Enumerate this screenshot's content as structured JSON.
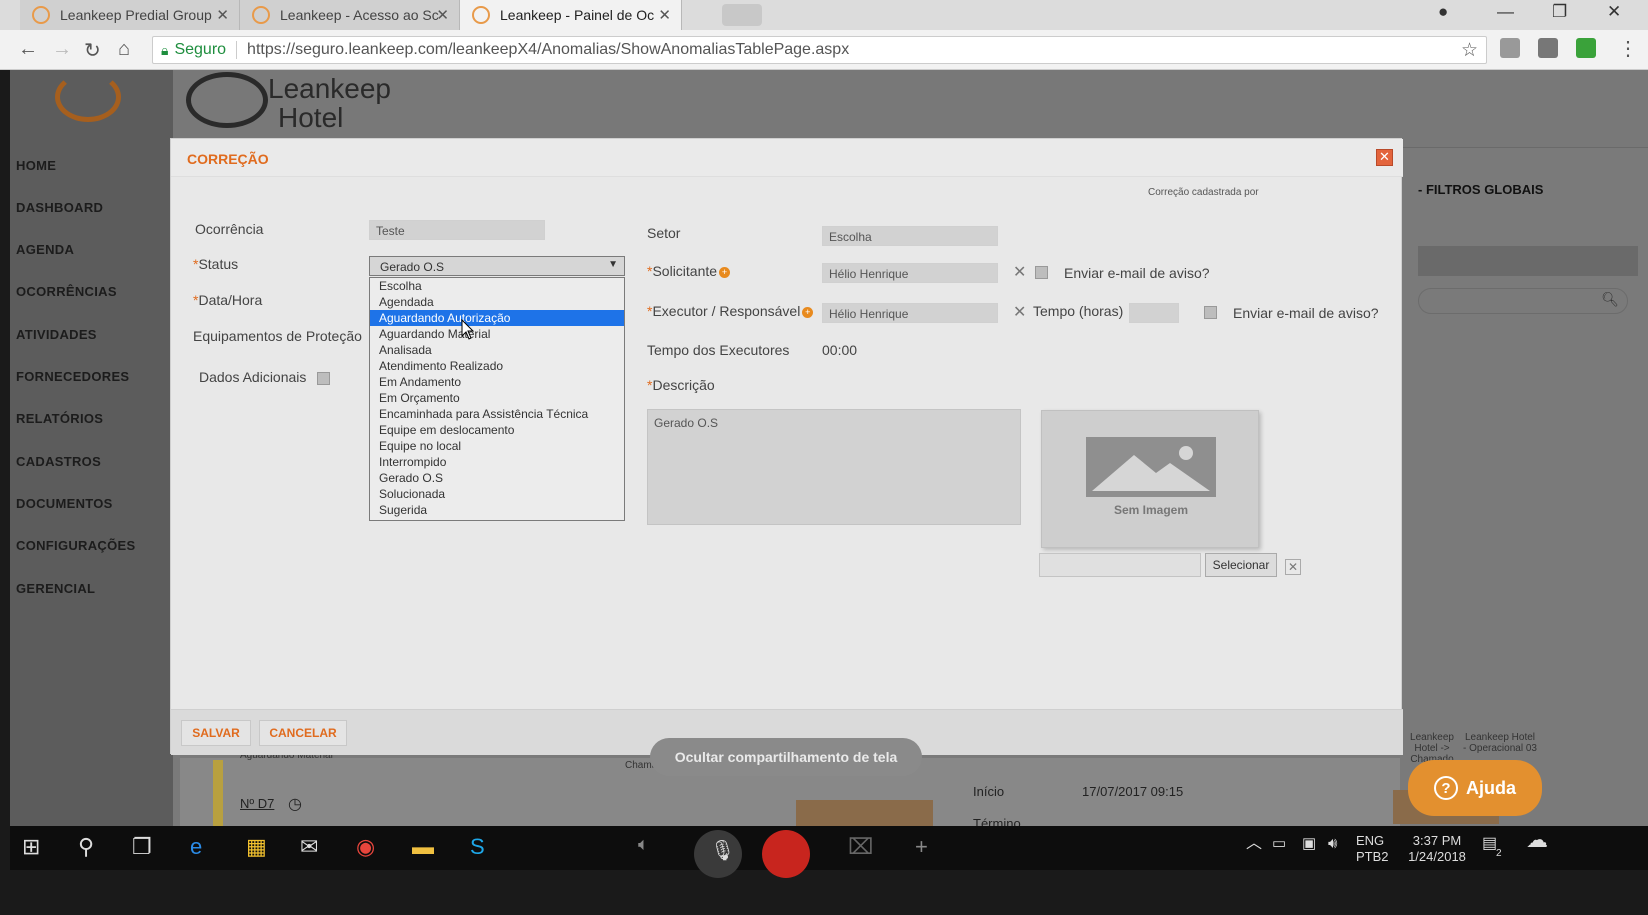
{
  "browser": {
    "tabs": [
      {
        "title": "Leankeep Predial Group"
      },
      {
        "title": "Leankeep - Acesso ao Sc"
      },
      {
        "title": "Leankeep - Painel de Oc"
      }
    ],
    "secure_label": "Seguro",
    "url": "https://seguro.leankeep.com/leankeepX4/Anomalias/ShowAnomaliasTablePage.aspx"
  },
  "brand": {
    "line1": "Leankeep",
    "line2": "Hotel"
  },
  "sidebar": {
    "items": [
      "HOME",
      "DASHBOARD",
      "AGENDA",
      "OCORRÊNCIAS",
      "ATIVIDADES",
      "FORNECEDORES",
      "RELATÓRIOS",
      "CADASTROS",
      "DOCUMENTOS",
      "CONFIGURAÇÕES",
      "GERENCIAL"
    ]
  },
  "right_panel": {
    "filtros": "- FILTROS GLOBAIS"
  },
  "background": {
    "aguardando": "Aguardando Material",
    "chamado": "Chamado",
    "num": "Nº D7",
    "inicio_label": "Início",
    "inicio_value": "17/07/2017 09:15",
    "termino_label": "Término",
    "card1": "Leankeep Hotel -> Chamado",
    "card2": "Leankeep Hotel - Operacional 03",
    "num03": "03"
  },
  "modal": {
    "title": "CORREÇÃO",
    "cadastrada": "Correção cadastrada por",
    "ocorrencia_label": "Ocorrência",
    "ocorrencia_value": "Teste",
    "status_label": "Status",
    "status_value": "Gerado O.S",
    "datahora_label": "Data/Hora",
    "equip_label": "Equipamentos de Proteção",
    "dados_label": "Dados Adicionais",
    "status_options": [
      "Escolha",
      "Agendada",
      "Aguardando Autorização",
      "Aguardando Material",
      "Analisada",
      "Atendimento Realizado",
      "Em Andamento",
      "Em Orçamento",
      "Encaminhada para Assistência Técnica",
      "Equipe em deslocamento",
      "Equipe no local",
      "Interrompido",
      "Gerado O.S",
      "Solucionada",
      "Sugerida"
    ],
    "status_highlighted": "Aguardando Autorização",
    "setor_label": "Setor",
    "setor_value": "Escolha",
    "solicitante_label": "Solicitante",
    "solicitante_value": "Hélio Henrique",
    "enviar_label": "Enviar e-mail de aviso?",
    "executor_label": "Executor / Responsável",
    "executor_value": "Hélio Henrique",
    "tempo_label": "Tempo (horas)",
    "tempo_exec_label": "Tempo dos Executores",
    "tempo_exec_value": "00:00",
    "descricao_label": "Descrição",
    "descricao_value": "Gerado O.S",
    "sem_imagem": "Sem Imagem",
    "selecionar": "Selecionar",
    "salvar": "SALVAR",
    "cancelar": "CANCELAR"
  },
  "overlay": {
    "ocultar": "Ocultar compartilhamento de tela",
    "ajuda": "Ajuda"
  },
  "taskbar": {
    "lang1": "ENG",
    "lang2": "PTB2",
    "time": "3:37 PM",
    "date": "1/24/2018",
    "notif": "2"
  },
  "colors": {
    "accent": "#e06b1e",
    "highlight": "#1e73e8",
    "ajuda": "#e3902f"
  }
}
